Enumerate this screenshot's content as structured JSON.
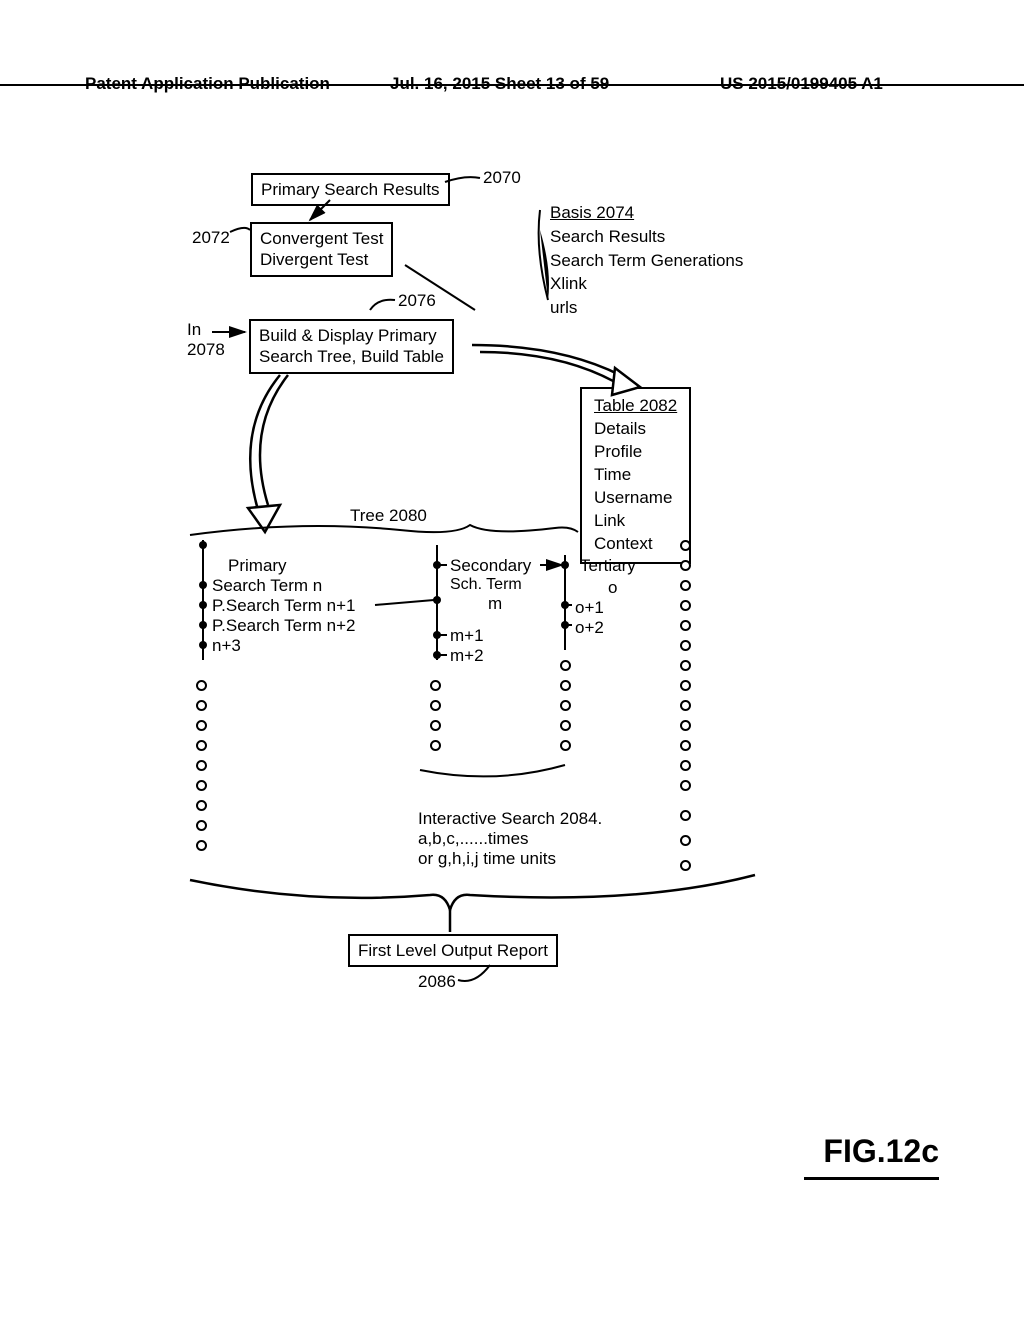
{
  "header": {
    "left": "Patent Application Publication",
    "mid": "Jul. 16, 2015  Sheet 13 of 59",
    "right": "US 2015/0199405 A1"
  },
  "box2070": "Primary Search Results",
  "ref2070": "2070",
  "ref2072": "2072",
  "box2072_l1": "Convergent Test",
  "box2072_l2": "Divergent Test",
  "basis": {
    "title": "Basis 2074",
    "l1": "Search Results",
    "l2": "Search Term Generations",
    "l3": "Xlink",
    "l4": "urls"
  },
  "ref2076": "2076",
  "in2078_l1": "In",
  "in2078_l2": "2078",
  "box2076_l1": "Build & Display Primary",
  "box2076_l2": "Search Tree, Build Table",
  "table": {
    "title": "Table 2082",
    "l1": "Details",
    "l2": "Profile",
    "l3": "Time",
    "l4": "Username",
    "l5": "Link",
    "l6": "Context"
  },
  "tree_label": "Tree 2080",
  "tree": {
    "p1": "Primary",
    "p2": "Search Term n",
    "p3": "P.Search Term n+1",
    "p4": "P.Search Term n+2",
    "p5": "n+3",
    "s1": "Secondary",
    "s2": "Sch. Term",
    "s3": "m",
    "s4": "m+1",
    "s5": "m+2",
    "t1": "Tertiary",
    "t2": "o",
    "t3": "o+1",
    "t4": "o+2"
  },
  "interactive": {
    "l1": "Interactive Search 2084.",
    "l2": "a,b,c,......times",
    "l3": "or g,h,i,j time units"
  },
  "box2086": "First Level Output Report",
  "ref2086": "2086",
  "fig": "FIG.12c"
}
